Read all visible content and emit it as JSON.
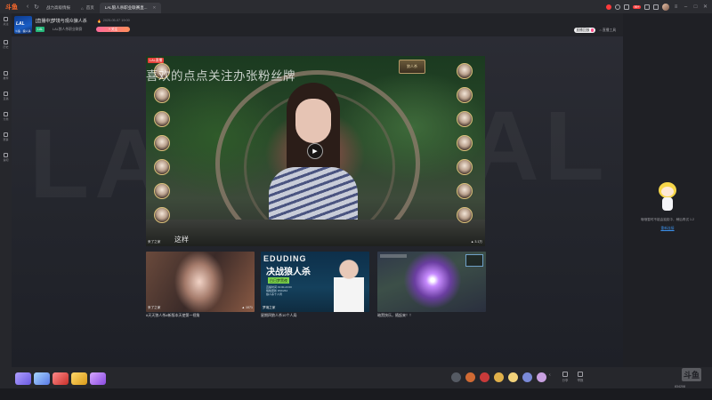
{
  "browser": {
    "logo": "斗鱼",
    "tabs": [
      {
        "label": "战力高级情报",
        "active": false
      },
      {
        "label": "首页",
        "active": false
      },
      {
        "label": "LAL狼人杀职业联赛直...",
        "active": true
      }
    ],
    "top_badge": "99+"
  },
  "sidebar": {
    "items": [
      {
        "label": "关注"
      },
      {
        "label": "历史"
      },
      {
        "label": "推荐"
      },
      {
        "label": "直播"
      },
      {
        "label": "分类"
      },
      {
        "label": "赛事"
      },
      {
        "label": "鱼吧"
      }
    ]
  },
  "room": {
    "title": "[直播中]梦境与观众狼人杀",
    "meta": "2025-05-07 19:00",
    "tag": "LAL",
    "category": "LAL狼人杀职业联赛",
    "follow": "+ 关注",
    "avatar_text": "LAL",
    "avatar_sub": "斗鱼 · 狼人杀",
    "right_pill": "直播回放",
    "report": "直播工具"
  },
  "video": {
    "caption": "喜欢的点点关注办张粉丝牌",
    "live_tag": "LAL直播",
    "badge": "狼人杀",
    "subtitle": "这样",
    "source": "来了之家",
    "views": "3.1万"
  },
  "cards": [
    {
      "title": "#天天狼人杀#新版本天使第一视角",
      "name": "来了之家",
      "views": "1071"
    },
    {
      "title": "星期四狼人杀10个人局",
      "name": "梦境之家",
      "views": "",
      "banner_top": "EDUDING",
      "banner_main": "决战狼人杀",
      "banner_sub": "白日梦黑夜",
      "lines": [
        "直播时间 19:00-23:00",
        "每晚更新 RSK264",
        "狼人杀十人局"
      ]
    },
    {
      "title": "暗黑快乐，随起来！！",
      "name": "",
      "views": ""
    }
  ],
  "right_panel": {
    "message": "哦哦暂时不能由抽奖中，稍后再试",
    "count": "1.2",
    "link": "重新连接"
  },
  "giftbar": {
    "share": "分享",
    "report": "举报"
  },
  "douyu": {
    "logo": "斗鱼",
    "room_id": "834208"
  },
  "colors": {
    "accent": "#ff6a2b",
    "follow_gradient_start": "#ff6b9a",
    "live_tag": "#e8413a",
    "link": "#3b8fe8"
  }
}
